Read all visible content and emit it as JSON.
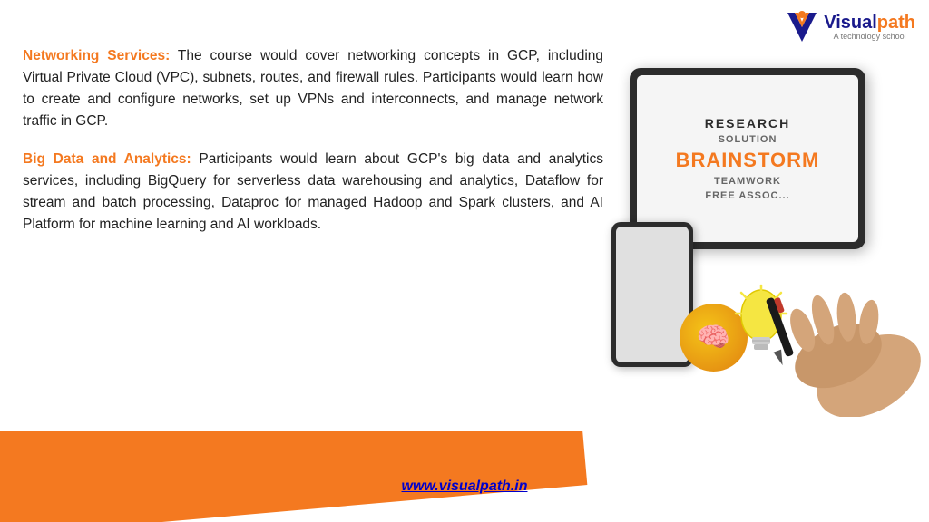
{
  "logo": {
    "visual": "Visual",
    "path": "path",
    "tagline": "A technology school",
    "icon": "V"
  },
  "networking_section": {
    "title": "Networking Services:",
    "body": " The course would cover networking concepts in GCP, including Virtual Private Cloud (VPC), subnets, routes, and firewall rules. Participants would learn how to create and configure networks, set up VPNs and interconnects, and manage network traffic in GCP."
  },
  "bigdata_section": {
    "title": "Big Data and Analytics:",
    "body": " Participants would learn about GCP's big data and analytics services, including BigQuery for serverless data warehousing and analytics, Dataflow for stream and batch processing, Dataproc for managed Hadoop and Spark clusters, and AI Platform for machine learning and AI workloads."
  },
  "website": {
    "label": "www.visualpath.in",
    "url": "www.visualpath.in"
  },
  "brainstorm_card": {
    "line1": "RESEARCH",
    "line2": "SOLUTION",
    "line3": "BRAINSTORM",
    "line4": "TEAMWORK",
    "line5": "FREE ASSOC..."
  }
}
